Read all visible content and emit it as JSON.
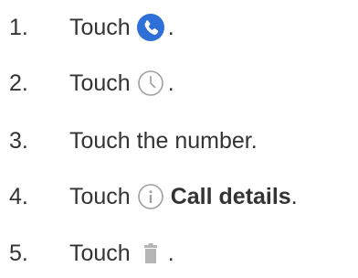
{
  "steps": [
    {
      "number": "1.",
      "prefix": "Touch",
      "icon": "phone-icon",
      "suffix": "."
    },
    {
      "number": "2.",
      "prefix": "Touch",
      "icon": "clock-icon",
      "suffix": "."
    },
    {
      "number": "3.",
      "text": "Touch the number."
    },
    {
      "number": "4.",
      "prefix": "Touch",
      "icon": "info-icon",
      "bold": "Call details",
      "suffix": "."
    },
    {
      "number": "5.",
      "prefix": "Touch",
      "icon": "trash-icon",
      "suffix": "."
    }
  ],
  "colors": {
    "text": "#333333",
    "phone_circle": "#2F6FD8",
    "icon_gray": "#A0A0A0",
    "trash_gray": "#B5B5B5"
  }
}
